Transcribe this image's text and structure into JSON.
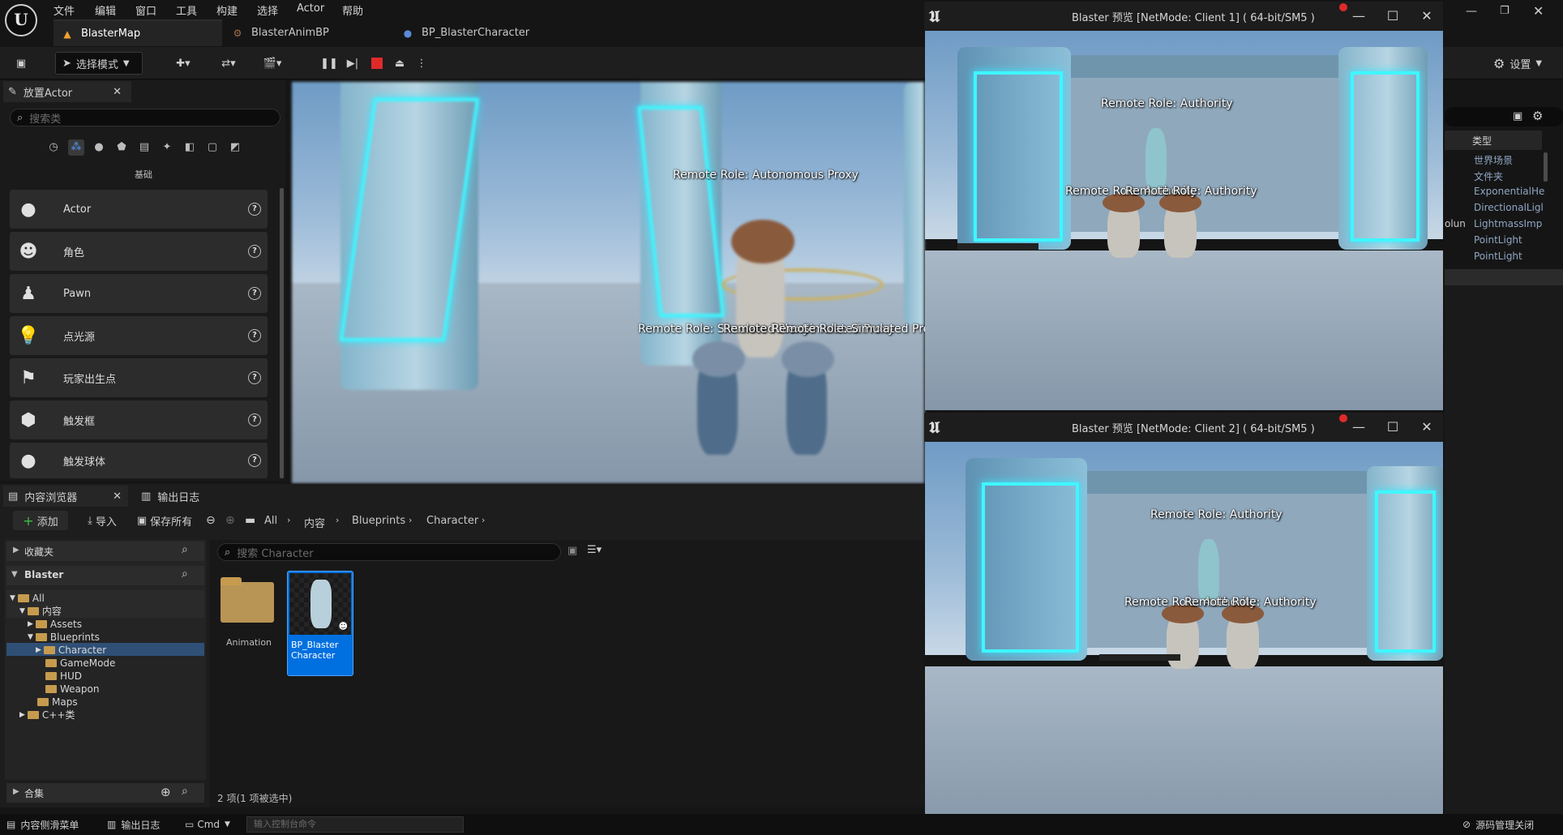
{
  "menubar": {
    "items": [
      "文件",
      "编辑",
      "窗口",
      "工具",
      "构建",
      "选择",
      "Actor",
      "帮助"
    ]
  },
  "doc_tabs": [
    {
      "label": "BlasterMap",
      "icon": "map-icon"
    },
    {
      "label": "BlasterAnimBP",
      "icon": "anim-blueprint-icon"
    },
    {
      "label": "BP_BlasterCharacter",
      "icon": "character-icon"
    }
  ],
  "toolbar": {
    "mode_label": "选择模式",
    "settings_label": "设置"
  },
  "place_actors": {
    "tab_title": "放置Actor",
    "search_placeholder": "搜索类",
    "category_label": "基础",
    "items": [
      {
        "label": "Actor",
        "icon": "sphere-icon"
      },
      {
        "label": "角色",
        "icon": "character-icon"
      },
      {
        "label": "Pawn",
        "icon": "pawn-icon"
      },
      {
        "label": "点光源",
        "icon": "light-bulb-icon"
      },
      {
        "label": "玩家出生点",
        "icon": "player-start-icon"
      },
      {
        "label": "触发框",
        "icon": "cube-icon"
      },
      {
        "label": "触发球体",
        "icon": "sphere-icon"
      }
    ]
  },
  "main_viewport": {
    "labels": [
      "Remote Role: Autonomous Proxy",
      "Remote Role: Simulated Proxy",
      "Remote Role: Simulated Proxy",
      "Remote Role: Simulated Proxy"
    ]
  },
  "client_windows": [
    {
      "title": "Blaster 预览 [NetMode: Client 1]  ( 64-bit/SM5 )",
      "labels": [
        "Remote Role: Authority",
        "Remote Role: Authority",
        "Remote Role: Authority"
      ]
    },
    {
      "title": "Blaster 预览 [NetMode: Client 2]  ( 64-bit/SM5 )",
      "labels": [
        "Remote Role: Authority",
        "Remote Role: Authority",
        "Remote Role: Authority"
      ]
    }
  ],
  "content_browser": {
    "tab_title": "内容浏览器",
    "log_tab": "输出日志",
    "add_label": "添加",
    "import_label": "导入",
    "save_all_label": "保存所有",
    "breadcrumb": [
      "All",
      "内容",
      "Blueprints",
      "Character"
    ],
    "favorites_label": "收藏夹",
    "project_label": "Blaster",
    "tree": [
      {
        "label": "All",
        "depth": 0,
        "open": true
      },
      {
        "label": "内容",
        "depth": 1,
        "open": true
      },
      {
        "label": "Assets",
        "depth": 2,
        "open": false
      },
      {
        "label": "Blueprints",
        "depth": 2,
        "open": true
      },
      {
        "label": "Character",
        "depth": 3,
        "open": false,
        "selected": true
      },
      {
        "label": "GameMode",
        "depth": 3,
        "open": false
      },
      {
        "label": "HUD",
        "depth": 3,
        "open": false
      },
      {
        "label": "Weapon",
        "depth": 3,
        "open": false
      },
      {
        "label": "Maps",
        "depth": 2,
        "open": false
      },
      {
        "label": "C++类",
        "depth": 1,
        "open": false
      }
    ],
    "collections_label": "合集",
    "search_placeholder": "搜索 Character",
    "assets": [
      {
        "label": "Animation",
        "type": "folder"
      },
      {
        "label": "BP_Blaster Character",
        "type": "blueprint",
        "selected": true
      }
    ],
    "status": "2 项(1 项被选中)"
  },
  "outliner": {
    "header": "类型",
    "rows": [
      "世界场景",
      "文件夹",
      "ExponentialHe",
      "DirectionalLigl",
      "LightmassImp",
      "PointLight",
      "PointLight"
    ],
    "side_text": "olun"
  },
  "statusbar": {
    "drawer": "内容侧滑菜单",
    "log": "输出日志",
    "cmd": "Cmd",
    "console_placeholder": "输入控制台命令",
    "source_control": "源码管理关闭"
  },
  "colors": {
    "accent": "#0070e0",
    "selection": "#2f4f75",
    "folder": "#c69b4e",
    "stop": "#e02a2a",
    "glow": "#3ff6ff"
  }
}
